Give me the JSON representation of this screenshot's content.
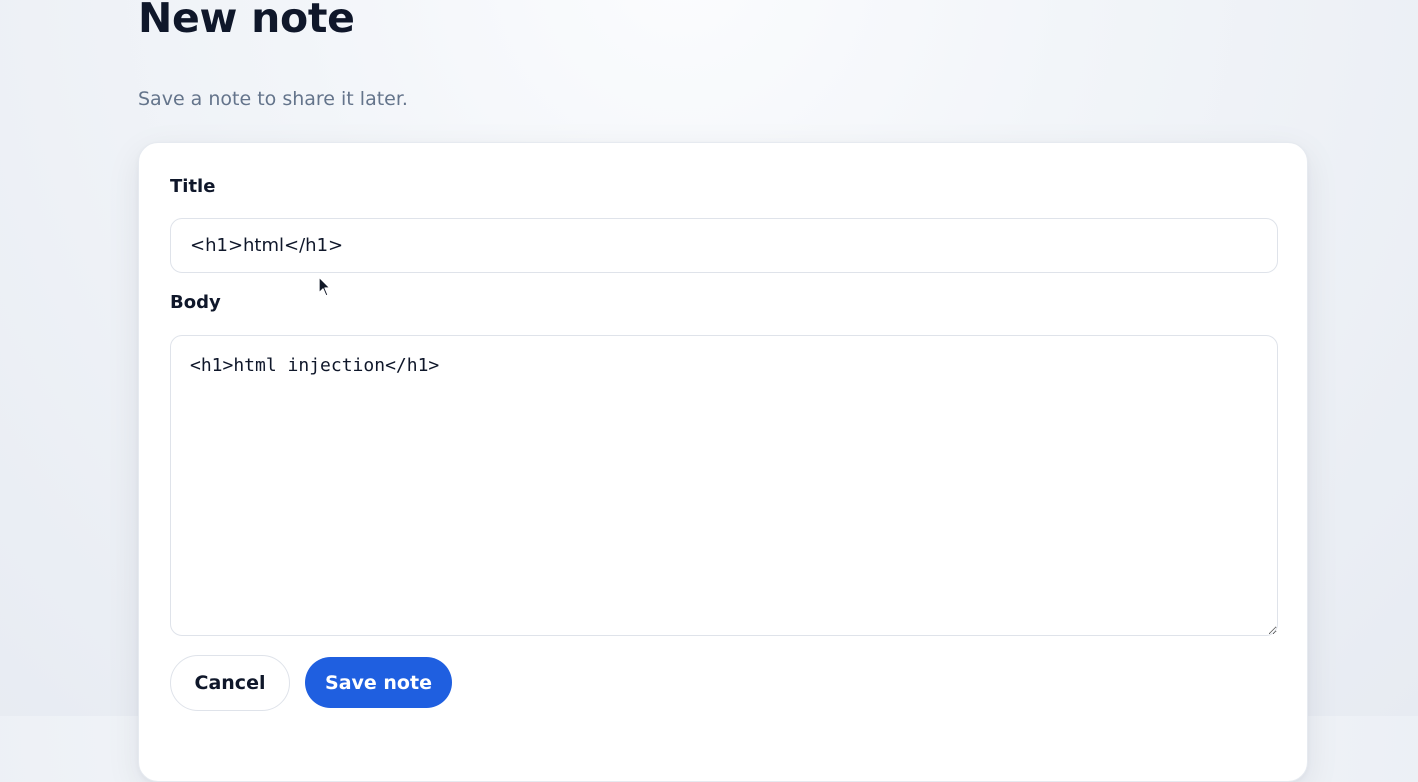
{
  "header": {
    "title": "New note",
    "subtitle": "Save a note to share it later."
  },
  "form": {
    "title_label": "Title",
    "title_value": "<h1>html</h1>",
    "body_label": "Body",
    "body_value": "<h1>html injection</h1>"
  },
  "actions": {
    "cancel_label": "Cancel",
    "save_label": "Save note"
  },
  "colors": {
    "primary": "#1f5fe0",
    "text": "#0f172a",
    "muted": "#64748b",
    "border": "#dfe3ea"
  },
  "icons": {
    "cursor": "mouse-pointer-icon"
  }
}
